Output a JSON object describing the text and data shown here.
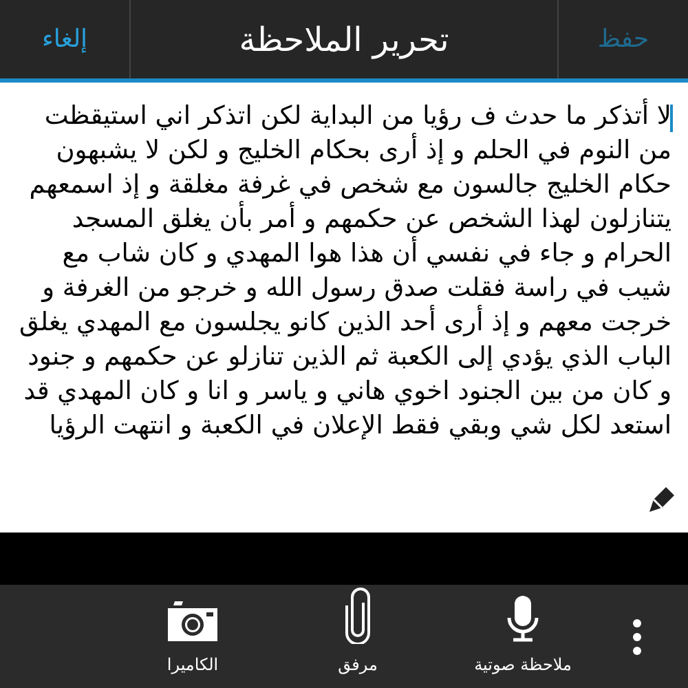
{
  "header": {
    "cancel": "إلغاء",
    "title": "تحرير الملاحظة",
    "save": "حفظ"
  },
  "note": {
    "text": "لا أتذكر ما حدث ف رؤيا من البداية لكن اتذكر اني استيقظت من النوم في الحلم و إذ أرى بحكام الخليج و لكن لا يشبهون حكام الخليج جالسون مع شخص في غرفة مغلقة و إذ اسمعهم يتنازلون لهذا الشخص عن حكمهم و أمر بأن يغلق المسجد الحرام و جاء في نفسي أن هذا هوا المهدي و كان شاب مع شيب في راسة فقلت صدق رسول الله و خرجو من الغرفة و خرجت معهم و إذ أرى أحد الذين كانو يجلسون مع المهدي يغلق الباب الذي يؤدي إلى الكعبة ثم الذين تنازلو عن حكمهم و جنود و كان من بين الجنود اخوي هاني و ياسر و انا و كان المهدي قد استعد لكل شي وبقي فقط الإعلان في الكعبة و انتهت الرؤيا"
  },
  "toolbar": [
    {
      "kind": "voice",
      "label": "ملاحظة صوتية"
    },
    {
      "kind": "attachment",
      "label": "مرفق"
    },
    {
      "kind": "camera",
      "label": "الكاميرا"
    }
  ]
}
